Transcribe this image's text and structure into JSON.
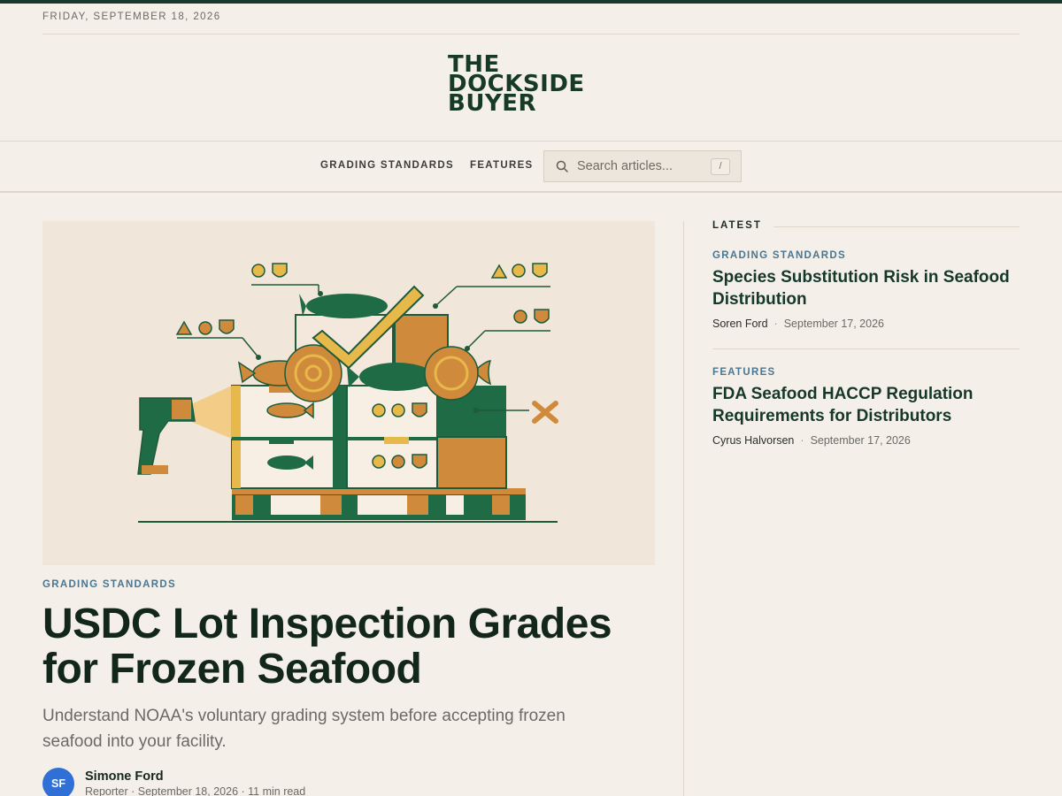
{
  "date": "FRIDAY, SEPTEMBER 18, 2026",
  "brand": {
    "logo_lines": [
      "THE",
      "DOCKSIDE",
      "BUYER"
    ],
    "colors": {
      "primary": "#17382a",
      "accent_link": "#4a7691",
      "avatar": "#2f6fd6"
    }
  },
  "nav": {
    "items": [
      "GRADING STANDARDS",
      "FEATURES"
    ],
    "search": {
      "placeholder": "Search articles...",
      "shortcut": "/",
      "icon": "search-icon"
    }
  },
  "feature": {
    "kicker": "GRADING STANDARDS",
    "title": "USDC Lot Inspection Grades for Frozen Seafood",
    "dek": "Understand NOAA's voluntary grading system before accepting frozen seafood into your facility.",
    "author": {
      "initials": "SF",
      "name": "Simone Ford",
      "meta": "Reporter · September 18, 2026 · 11 min read"
    }
  },
  "latest": {
    "label": "LATEST",
    "items": [
      {
        "kicker": "GRADING STANDARDS",
        "title": "Species Substitution Risk in Seafood Distribution",
        "author": "Soren Ford",
        "date": "September 17, 2026"
      },
      {
        "kicker": "FEATURES",
        "title": "FDA Seafood HACCP Regulation Requirements for Distributors",
        "author": "Cyrus Halvorsen",
        "date": "September 17, 2026"
      }
    ]
  }
}
